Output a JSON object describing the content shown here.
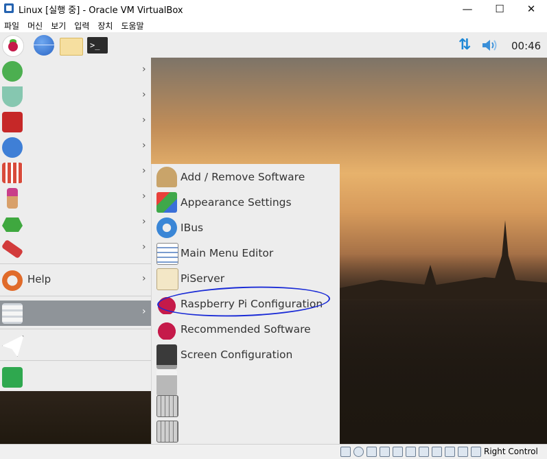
{
  "window": {
    "title": "Linux [실행 중] - Oracle VM VirtualBox",
    "minimize": "—",
    "maximize": "☐",
    "close": "✕"
  },
  "menubar": [
    "파일",
    "머신",
    "보기",
    "입력",
    "장치",
    "도움말"
  ],
  "taskbar": {
    "clock": "00:46",
    "terminal_glyph": ">_"
  },
  "main_menu": {
    "items": [
      {
        "label": "",
        "icon": "programming-icon",
        "color": "#4caf50"
      },
      {
        "label": "",
        "icon": "education-icon",
        "color": "#86c7b0"
      },
      {
        "label": "",
        "icon": "office-icon",
        "color": "#c62828"
      },
      {
        "label": "",
        "icon": "internet-icon",
        "color": "#3f7fd6"
      },
      {
        "label": "",
        "icon": "sound-video-icon",
        "color": "#d84a3a"
      },
      {
        "label": "",
        "icon": "graphics-icon",
        "color": "#d8a06a"
      },
      {
        "label": "",
        "icon": "games-icon",
        "color": "#3fa83f"
      },
      {
        "label": "",
        "icon": "accessories-icon",
        "color": "#d23b3b"
      }
    ],
    "help": "Help",
    "preferences": "",
    "run": "",
    "shutdown": ""
  },
  "submenu": {
    "items": [
      {
        "label": "Add / Remove Software",
        "icon": "package-icon"
      },
      {
        "label": "Appearance Settings",
        "icon": "appearance-icon"
      },
      {
        "label": "IBus",
        "icon": "ibus-icon"
      },
      {
        "label": "Main Menu Editor",
        "icon": "menu-editor-icon"
      },
      {
        "label": "PiServer",
        "icon": "piserver-icon"
      },
      {
        "label": "Raspberry Pi Configuration",
        "icon": "raspberry-icon"
      },
      {
        "label": "Recommended Software",
        "icon": "raspberry-icon"
      },
      {
        "label": "Screen Configuration",
        "icon": "monitor-icon"
      },
      {
        "label": "",
        "icon": "printer-icon"
      },
      {
        "label": "",
        "icon": "keyboard-icon"
      },
      {
        "label": "",
        "icon": "keyboard-mouse-icon"
      }
    ]
  },
  "statusbar": {
    "host_key": "Right Control"
  },
  "colors": {
    "accent": "#1e88d6",
    "selected": "#8f9499",
    "annotation": "#1a2bd6",
    "raspberry": "#c51a4a"
  }
}
